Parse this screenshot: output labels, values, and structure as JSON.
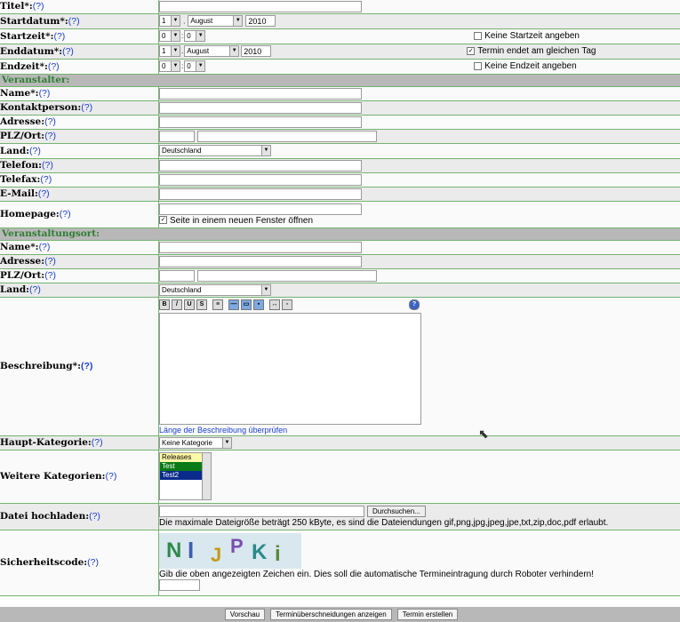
{
  "help": "(?)",
  "fields": {
    "titel": "Titel*:",
    "startdatum": "Startdatum*:",
    "startzeit": "Startzeit*:",
    "enddatum": "Enddatum*:",
    "endzeit": "Endzeit*:"
  },
  "date": {
    "day": "1",
    "month": "August",
    "year": "2010",
    "hour": "0",
    "minute": "0"
  },
  "checkboxes": {
    "keine_startzeit": "Keine Startzeit angeben",
    "termin_endet": "Termin endet am gleichen Tag",
    "keine_endzeit": "Keine Endzeit angeben",
    "neues_fenster": "Seite in einem neuen Fenster öffnen"
  },
  "sections": {
    "veranstalter": "Veranstalter:",
    "ort": "Veranstaltungsort:"
  },
  "organizer": {
    "name": "Name*:",
    "kontakt": "Kontaktperson:",
    "adresse": "Adresse:",
    "plz": "PLZ/Ort:",
    "land": "Land:",
    "telefon": "Telefon:",
    "telefax": "Telefax:",
    "email": "E-Mail:",
    "homepage": "Homepage:",
    "land_value": "Deutschland"
  },
  "venue": {
    "name": "Name*:",
    "adresse": "Adresse:",
    "plz": "PLZ/Ort:",
    "land": "Land:",
    "land_value": "Deutschland"
  },
  "description": {
    "label": "Beschreibung*:",
    "check_link": "Länge der Beschreibung überprüfen"
  },
  "categories": {
    "main_label": "Haupt-Kategorie:",
    "main_value": "Keine Kategorie",
    "more_label": "Weitere Kategorien:",
    "items": [
      "Releases",
      "Test",
      "Test2"
    ]
  },
  "upload": {
    "label": "Datei hochladen:",
    "browse": "Durchsuchen...",
    "note": "Die maximale Dateigröße beträgt 250 kByte, es sind die Dateiendungen gif,png,jpg,jpeg,jpe,txt,zip,doc,pdf erlaubt."
  },
  "captcha": {
    "label": "Sicherheitscode:",
    "note": "Gib die oben angezeigten Zeichen ein. Dies soll die automatische Termineintragung durch Roboter verhindern!",
    "chars": [
      "N",
      "I",
      "J",
      "P",
      "K",
      "i"
    ]
  },
  "buttons": {
    "preview": "Vorschau",
    "overlap": "Terminüberschneidungen anzeigen",
    "create": "Termin erstellen"
  }
}
